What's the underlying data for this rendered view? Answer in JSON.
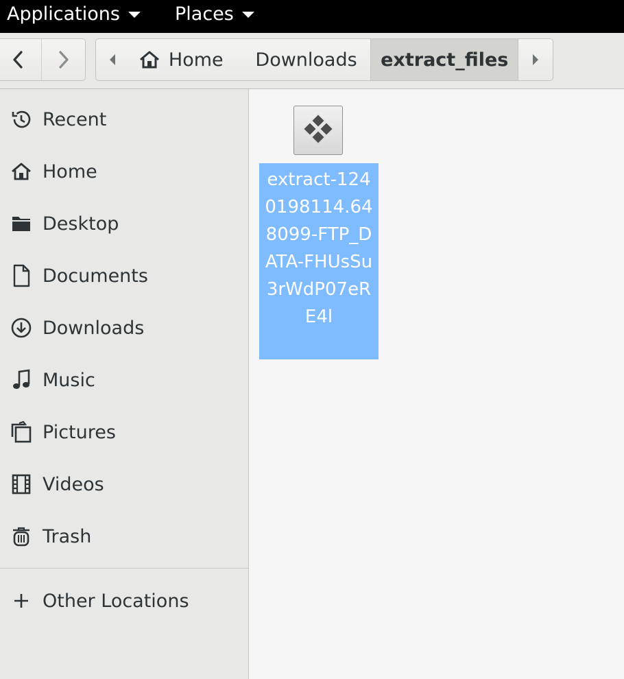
{
  "top_panel": {
    "applications_label": "Applications",
    "places_label": "Places"
  },
  "headerbar": {
    "back_icon": "chevron-left-icon",
    "forward_icon": "chevron-right-icon",
    "path": {
      "home_label": "Home",
      "downloads_label": "Downloads",
      "current_label": "extract_files"
    }
  },
  "sidebar": {
    "items": [
      {
        "label": "Recent",
        "icon": "clock-history-icon"
      },
      {
        "label": "Home",
        "icon": "home-icon"
      },
      {
        "label": "Desktop",
        "icon": "folder-icon"
      },
      {
        "label": "Documents",
        "icon": "document-icon"
      },
      {
        "label": "Downloads",
        "icon": "download-icon"
      },
      {
        "label": "Music",
        "icon": "music-note-icon"
      },
      {
        "label": "Pictures",
        "icon": "pictures-icon"
      },
      {
        "label": "Videos",
        "icon": "film-icon"
      },
      {
        "label": "Trash",
        "icon": "trash-icon"
      }
    ],
    "other_locations_label": "Other Locations"
  },
  "content": {
    "files": [
      {
        "name": "extract-1240198114.648099-FTP_DATA-FHUsSu3rWdP07eRE4l",
        "icon": "executable-file-icon",
        "selected": true
      }
    ]
  },
  "colors": {
    "selection": "#7fbcff",
    "top_panel": "#000000",
    "sidebar_bg": "#e8e8e7",
    "content_bg": "#f6f6f6"
  }
}
